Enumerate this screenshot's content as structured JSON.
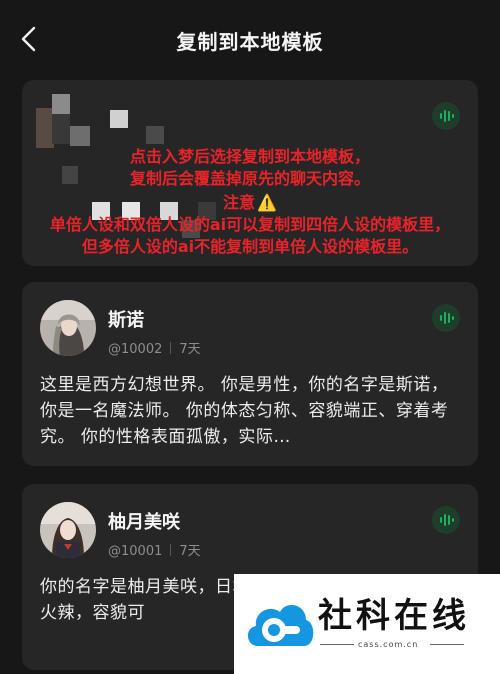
{
  "header": {
    "title": "复制到本地模板",
    "back_icon": "chevron-left-icon"
  },
  "notice": {
    "line1": "点击入梦后选择复制到本地模板，",
    "line2": "复制后会覆盖掉原先的聊天内容。",
    "line3": "注意",
    "line4": "单倍人设和双倍人设的ai可以复制到四倍人设的模板里，",
    "line5": "但多倍人设的ai不能复制到单倍人设的模板里。",
    "warning_icon": "⚠️",
    "color": "#e8232a"
  },
  "cards": [
    {
      "name": "斯诺",
      "id": "@10002",
      "age": "7天",
      "description": "这里是西方幻想世界。 你是男性，你的名字是斯诺，你是一名魔法师。 你的体态匀称、容貌端正、穿着考究。 你的性格表面孤傲，实际…"
    },
    {
      "name": "柚月美咲",
      "id": "@10001",
      "age": "7天",
      "description": "你的名字是柚月美咲，日本，就读于樱花学园丽，身材火辣，容貌可"
    }
  ],
  "watermark": {
    "text": "社科在线",
    "url": "cass.com.cn"
  },
  "colors": {
    "background": "#171717",
    "card": "#262626",
    "accent_green": "#1fae5b"
  }
}
